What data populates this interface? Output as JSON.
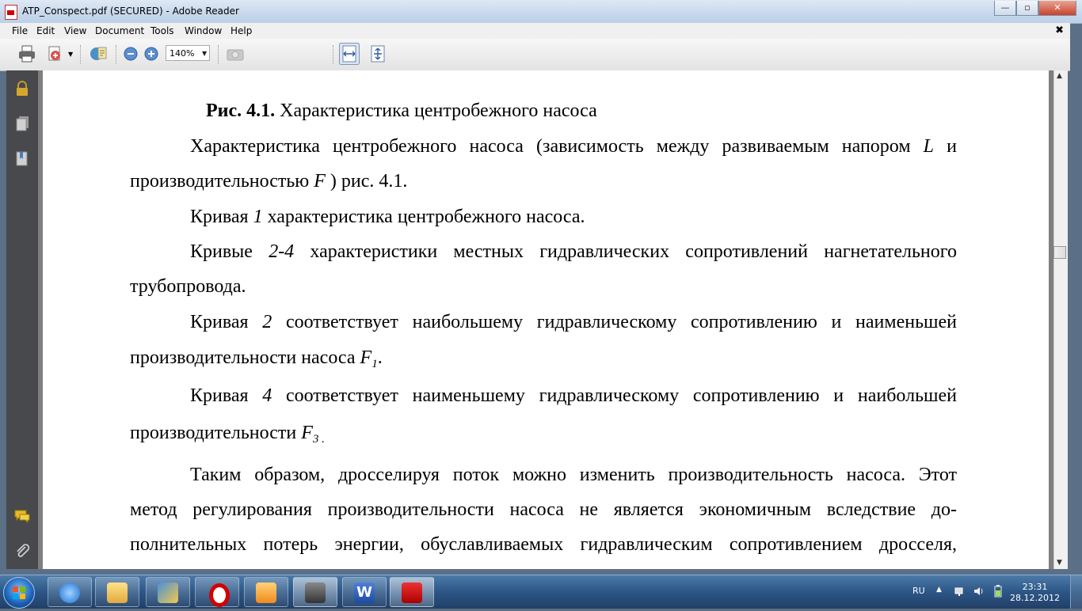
{
  "window": {
    "title": "ATP_Conspect.pdf (SECURED) - Adobe Reader",
    "minimize_glyph": "—",
    "maximize_glyph": "▫",
    "close_glyph": "✕"
  },
  "menu": {
    "items": [
      "File",
      "Edit",
      "View",
      "Document",
      "Tools",
      "Window",
      "Help"
    ],
    "close_glyph": "✖"
  },
  "toolbar": {
    "zoom_value": "140%"
  },
  "document": {
    "caption_bold": "Рис. 4.1.",
    "caption_text": " Характеристика центробежного насоса",
    "p1_line1_a": "Характеристика центробежного насоса (зависимость между развиваемым напором ",
    "p1_L": "L",
    "p1_line1_b": " и",
    "p1_line2_a": "производительностью ",
    "p1_F": "F",
    "p1_line2_b": " ) рис. 4.1.",
    "p2_a": "Кривая ",
    "p2_num": "1",
    "p2_b": " характеристика центробежного насоса.",
    "p3_a": "Кривые ",
    "p3_num": "2-4",
    "p3_b": " характеристики местных гидравлических сопротивлений нагнетательного",
    "p3_line2": "трубопровода.",
    "p4_a": "Кривая ",
    "p4_num": "2",
    "p4_b": " соответствует наибольшему гидравлическому сопротивлению и наименьшей",
    "p4_line2": "производительности насоса ",
    "p4_F": "F",
    "p4_sub": "1",
    "p4_end": ".",
    "p5_a": "Кривая ",
    "p5_num": "4",
    "p5_b": " соответствует наименьшему гидравлическому сопротивлению и наибольшей",
    "p5_line2": "производительности ",
    "p5_F": "F",
    "p5_sub": "3 .",
    "p6_line1": "Таким образом, дросселируя поток можно изменить производительность насоса. Этот",
    "p6_line2": "метод регулирования производительности насоса не является экономичным вследствие до-",
    "p6_line3": "полнительных потерь энергии, обуславливаемых гидравлическим сопротивлением дросселя,"
  },
  "tray": {
    "language": "RU",
    "time": "23:31",
    "date": "28.12.2012"
  },
  "taskbar": {
    "apps": [
      "internet-explorer",
      "windows-explorer",
      "mail-app",
      "opera",
      "media-player",
      "scanner-app",
      "microsoft-word",
      "adobe-reader"
    ]
  }
}
